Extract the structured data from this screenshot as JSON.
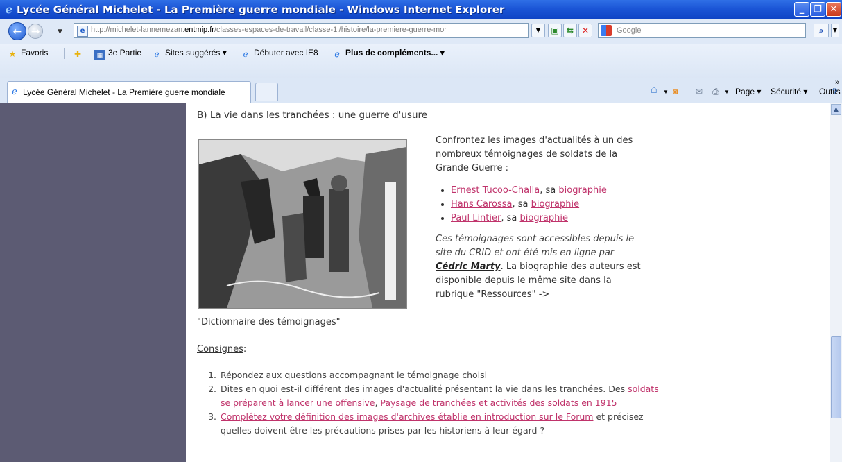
{
  "window": {
    "title": "Lycée Général Michelet - La Première guerre mondiale - Windows Internet Explorer",
    "minimize": "_",
    "maximize": "❐",
    "close": "✕"
  },
  "address_bar": {
    "url_prefix": "http://michelet-lannemezan.",
    "url_domain": "entmip.fr",
    "url_rest": "/classes-espaces-de-travail/classe-1l/histoire/la-premiere-guerre-mor",
    "search_placeholder": "Google"
  },
  "favorites_bar": {
    "favorites_label": "Favoris",
    "items": [
      "3e Partie",
      "Sites suggérés ▾",
      "Débuter avec IE8",
      "Plus de compléments... ▾"
    ]
  },
  "tabs": {
    "active_tab": "Lycée Général Michelet - La Première guerre mondiale"
  },
  "command_bar": {
    "page": "Page ▾",
    "security": "Sécurité ▾",
    "tools": "Outils ▾",
    "more": "»"
  },
  "content": {
    "heading": "B) La vie dans les tranchées : une guerre d'usure",
    "intro": "Confrontez les images d'actualités à un des nombreux témoignages de soldats de la Grande Guerre :",
    "witnesses": [
      {
        "name": "Ernest Tucoo-Challa",
        "sep": ", sa ",
        "bio": "biographie"
      },
      {
        "name": "Hans Carossa",
        "sep": ", sa ",
        "bio": "biographie"
      },
      {
        "name": "Paul Lintier",
        "sep": ", sa ",
        "bio": "biographie"
      }
    ],
    "note_part1": "Ces témoignages sont accessibles depuis le site du CRID et ont été mis en ligne par ",
    "note_author": "Cédric Marty",
    "note_part2": ". La biographie des auteurs est disponible depuis le même site dans la rubrique \"",
    "note_ressources": "Ressources",
    "note_part3": "\" ->",
    "dict": "\"Dictionnaire des témoignages\"",
    "consignes_title": "Consignes",
    "consignes_colon": " :",
    "steps": {
      "s1": "Répondez aux questions accompagnant le témoignage choisi",
      "s2_text": "Dites en quoi est-il différent des images d'actualité présentant la vie dans les tranchées. Des ",
      "s2_link1": "soldats se préparent à lancer une offensive",
      "s2_comma": ",  ",
      "s2_link2": "Paysage de tranchées et activités des soldats en 1915",
      "s3_link": "Complétez votre définition des images d'archives établie en introduction sur le Forum",
      "s3_text": " et précisez quelles doivent être les précautions prises par les historiens à leur égard ?"
    }
  },
  "colors": {
    "link": "#c0336b",
    "left_panel": "#5c5b73",
    "titlebar": "#1b55d6"
  }
}
